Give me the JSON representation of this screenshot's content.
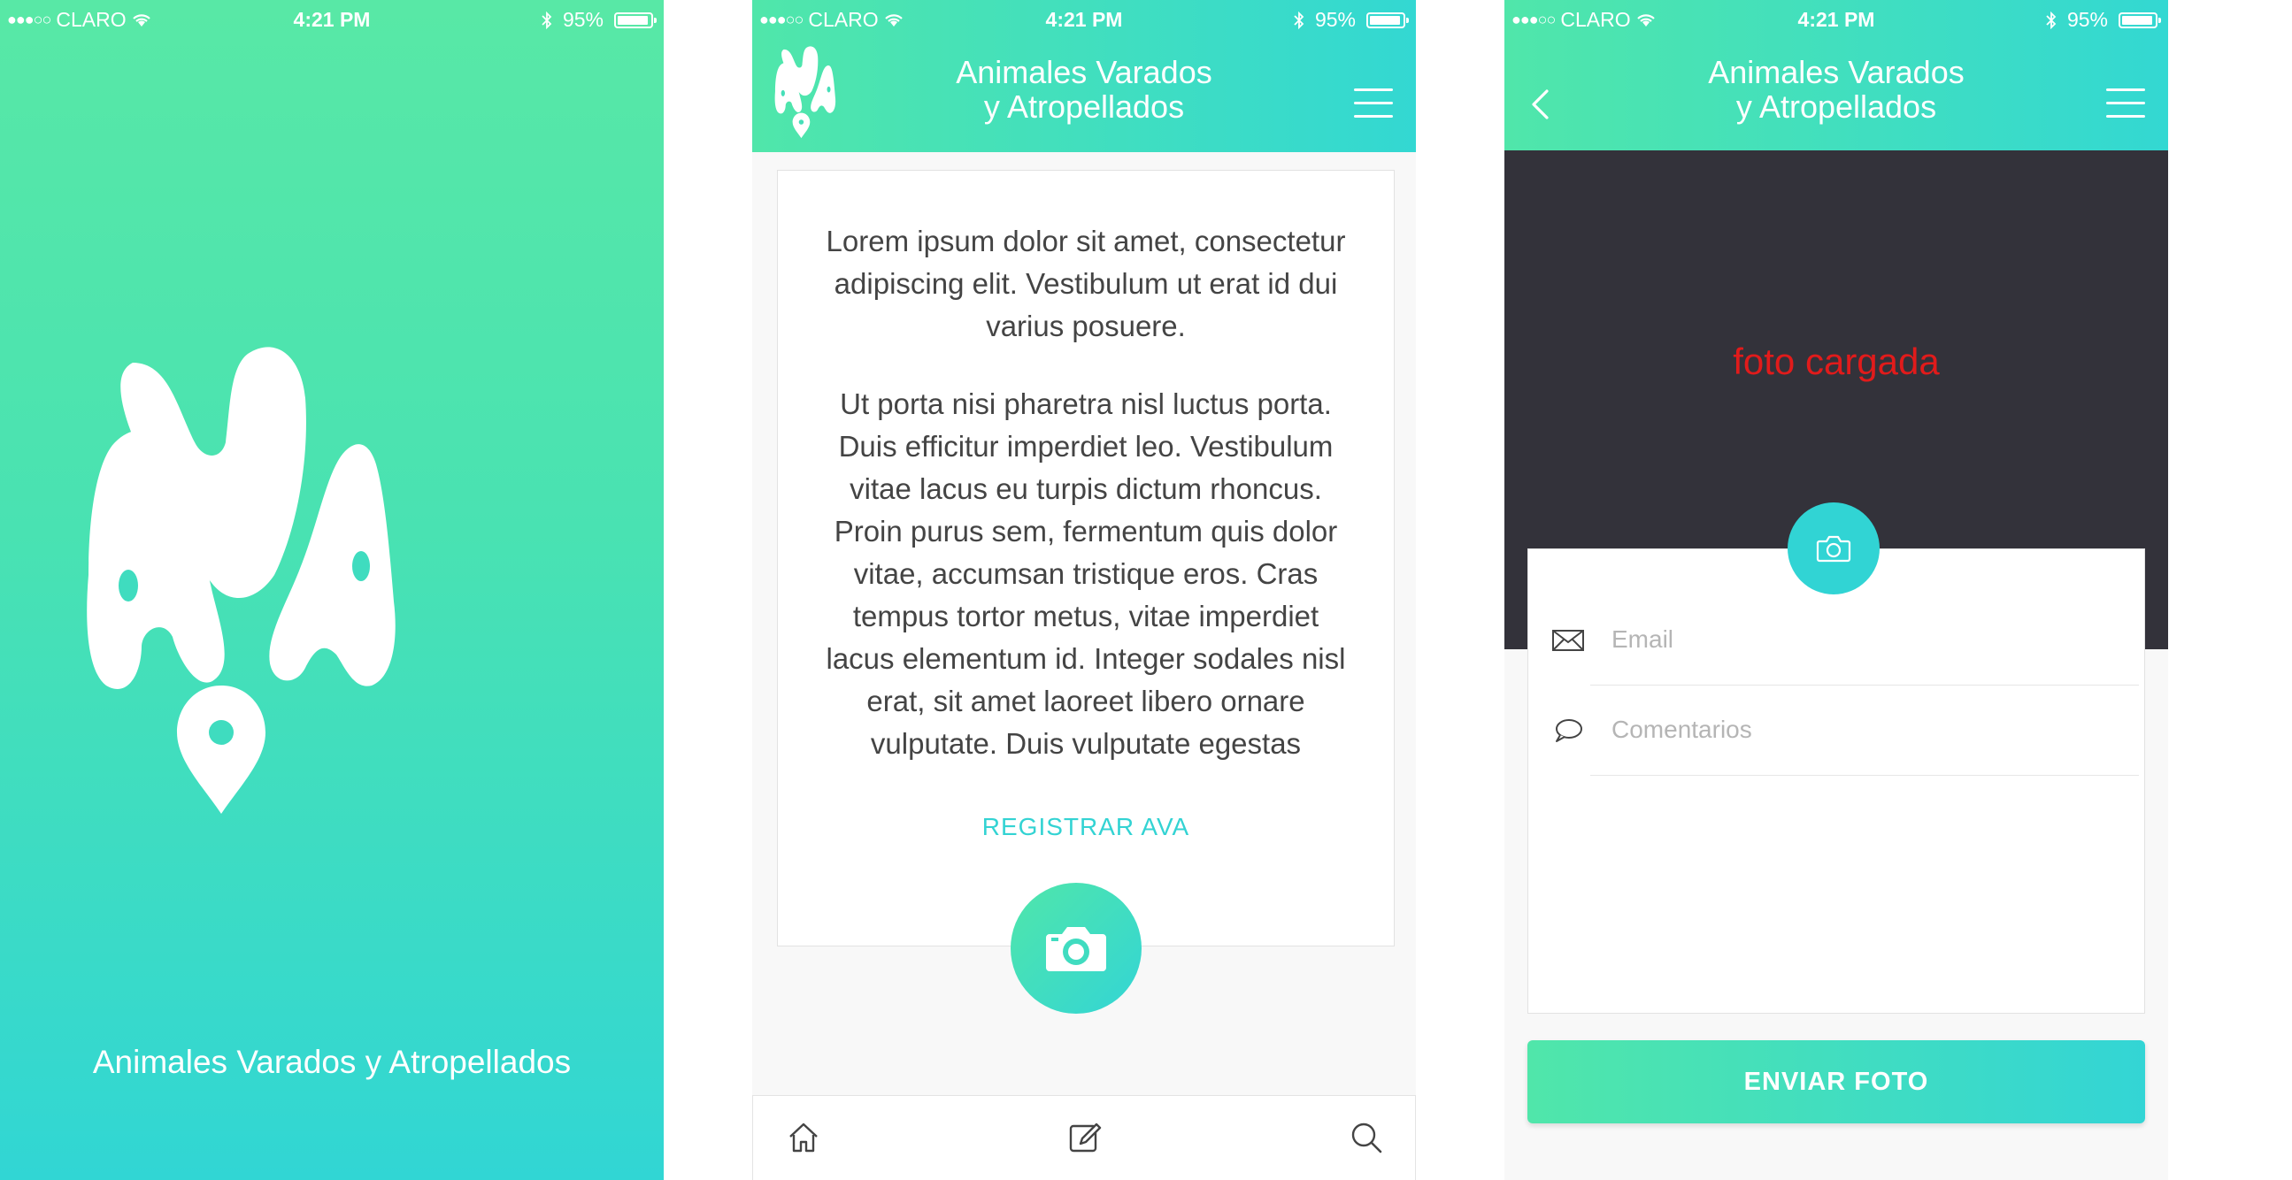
{
  "status_bar": {
    "signal": "●●●○○",
    "carrier": "CLARO",
    "time": "4:21 PM",
    "battery": "95%"
  },
  "splash": {
    "title": "Animales Varados y Atropellados"
  },
  "header": {
    "title_line1": "Animales Varados",
    "title_line2": "y Atropellados"
  },
  "home": {
    "paragraph1": "Lorem ipsum dolor sit amet, consectetur adipiscing elit. Vestibulum ut erat id dui varius posuere.",
    "paragraph2": "Ut porta nisi pharetra nisl luctus porta. Duis efficitur imperdiet leo. Vestibulum vitae lacus eu turpis dictum rhoncus. Proin purus sem, fermentum quis dolor vitae, accumsan tristique eros. Cras tempus tortor metus, vitae imperdiet lacus elementum id. Integer sodales nisl erat, sit amet laoreet libero ornare vulputate. Duis vulputate egestas",
    "register_link": "REGISTRAR AVA",
    "tabs": [
      "home-icon",
      "edit-icon",
      "search-icon"
    ]
  },
  "upload": {
    "photo_label": "foto cargada",
    "email_placeholder": "Email",
    "comments_placeholder": "Comentarios",
    "send_button": "ENVIAR FOTO"
  },
  "colors": {
    "gradient_start": "#50e6aa",
    "gradient_end": "#33d5d5",
    "photo_bg": "#33323a",
    "photo_label": "#e11b1b",
    "link": "#33d3d3"
  }
}
